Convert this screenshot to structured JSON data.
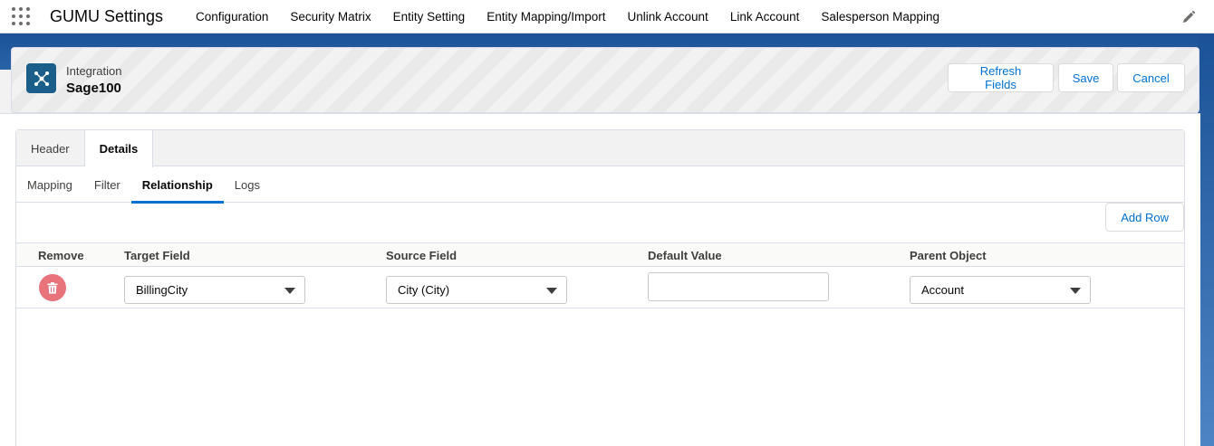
{
  "topnav": {
    "app_name": "GUMU Settings",
    "items": [
      "Configuration",
      "Security Matrix",
      "Entity Setting",
      "Entity Mapping/Import",
      "Unlink Account",
      "Link Account",
      "Salesperson Mapping"
    ]
  },
  "header": {
    "label": "Integration",
    "title": "Sage100",
    "buttons": {
      "refresh": "Refresh Fields",
      "save": "Save",
      "cancel": "Cancel"
    }
  },
  "tabs": {
    "primary": [
      "Header",
      "Details"
    ],
    "secondary": [
      "Mapping",
      "Filter",
      "Relationship",
      "Logs"
    ]
  },
  "toolbar": {
    "add_row": "Add Row"
  },
  "table": {
    "columns": [
      "Remove",
      "Target Field",
      "Source Field",
      "Default Value",
      "Parent Object"
    ],
    "rows": [
      {
        "target_field": "BillingCity",
        "source_field": "City (City)",
        "default_value": "",
        "parent_object": "Account"
      }
    ]
  },
  "colors": {
    "brand_blue": "#1b5297",
    "link_blue": "#0070d2",
    "remove_red": "#e8737b"
  }
}
